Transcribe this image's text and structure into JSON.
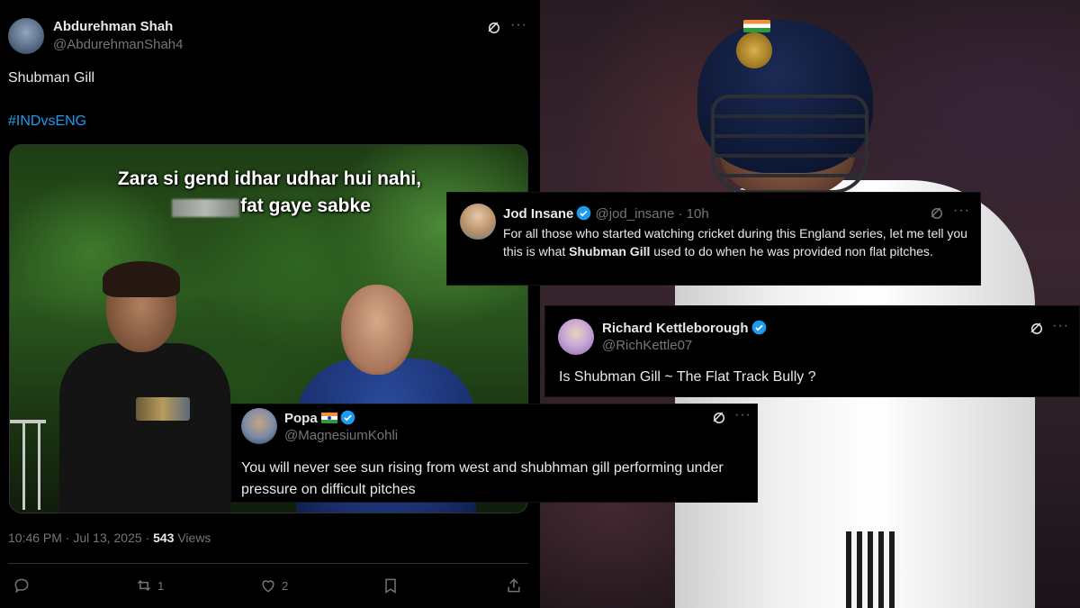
{
  "main_tweet": {
    "author_name": "Abdurehman Shah",
    "author_handle": "@AbdurehmanShah4",
    "text": "Shubman Gill",
    "hashtag": "#INDvsENG",
    "meme_caption_line1": "Zara si gend idhar udhar hui nahi,",
    "meme_caption_line2": "fat gaye sabke",
    "timestamp": "10:46 PM · Jul 13, 2025 · ",
    "views_count": "543",
    "views_label": " Views",
    "retweet_count": "1",
    "like_count": "2"
  },
  "replies": [
    {
      "name": "Jod Insane",
      "handle": "@jod_insane · 10h",
      "text_before": "For all those who started watching cricket during this England series, let me tell you  this is what ",
      "text_bold": "Shubman Gill",
      "text_after": " used to do when he was provided non flat pitches.",
      "verified": true
    },
    {
      "name": "Richard Kettleborough",
      "handle": "@RichKettle07",
      "text": "Is Shubman Gill ~ The Flat Track Bully ?",
      "verified": true
    },
    {
      "name": "Popa",
      "handle": "@MagnesiumKohli",
      "text": "You will never see sun rising from west and shubhman gill performing under pressure on difficult pitches",
      "verified": true
    }
  ],
  "colors": {
    "background": "#000000",
    "text_primary": "#e7e9ea",
    "text_secondary": "#71767b",
    "link": "#1d9bf0",
    "verified": "#1d9bf0"
  },
  "icons": [
    "grok-icon",
    "more-icon",
    "verified-icon",
    "reply-icon",
    "retweet-icon",
    "like-icon",
    "bookmark-icon",
    "share-icon",
    "india-flag-icon"
  ]
}
